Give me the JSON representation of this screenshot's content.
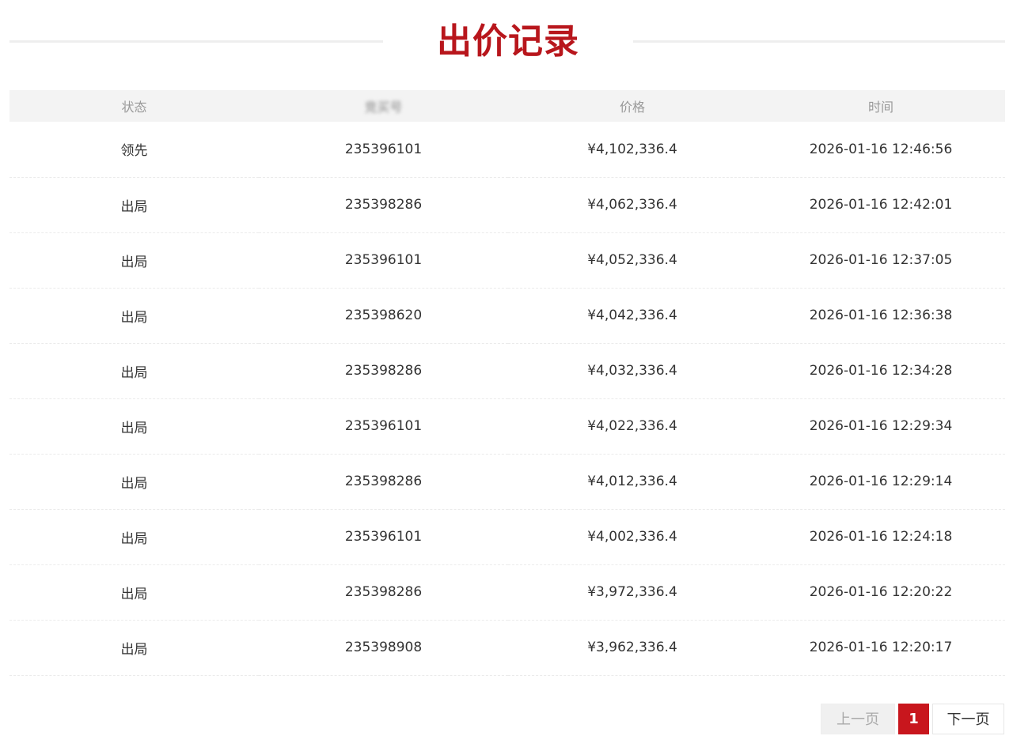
{
  "title": "出价记录",
  "colors": {
    "accent": "#b8161c",
    "header_bg": "#f3f3f3",
    "current_page_bg": "#c8161d"
  },
  "table": {
    "headers": [
      "状态",
      "竞买号",
      "价格",
      "时间"
    ],
    "rows": [
      {
        "status": "领先",
        "bidder": "235396101",
        "price": "¥4,102,336.4",
        "time": "2026-01-16 12:46:56"
      },
      {
        "status": "出局",
        "bidder": "235398286",
        "price": "¥4,062,336.4",
        "time": "2026-01-16 12:42:01"
      },
      {
        "status": "出局",
        "bidder": "235396101",
        "price": "¥4,052,336.4",
        "time": "2026-01-16 12:37:05"
      },
      {
        "status": "出局",
        "bidder": "235398620",
        "price": "¥4,042,336.4",
        "time": "2026-01-16 12:36:38"
      },
      {
        "status": "出局",
        "bidder": "235398286",
        "price": "¥4,032,336.4",
        "time": "2026-01-16 12:34:28"
      },
      {
        "status": "出局",
        "bidder": "235396101",
        "price": "¥4,022,336.4",
        "time": "2026-01-16 12:29:34"
      },
      {
        "status": "出局",
        "bidder": "235398286",
        "price": "¥4,012,336.4",
        "time": "2026-01-16 12:29:14"
      },
      {
        "status": "出局",
        "bidder": "235396101",
        "price": "¥4,002,336.4",
        "time": "2026-01-16 12:24:18"
      },
      {
        "status": "出局",
        "bidder": "235398286",
        "price": "¥3,972,336.4",
        "time": "2026-01-16 12:20:22"
      },
      {
        "status": "出局",
        "bidder": "235398908",
        "price": "¥3,962,336.4",
        "time": "2026-01-16 12:20:17"
      }
    ]
  },
  "pagination": {
    "prev_label": "上一页",
    "current_page": "1",
    "next_label": "下一页"
  }
}
